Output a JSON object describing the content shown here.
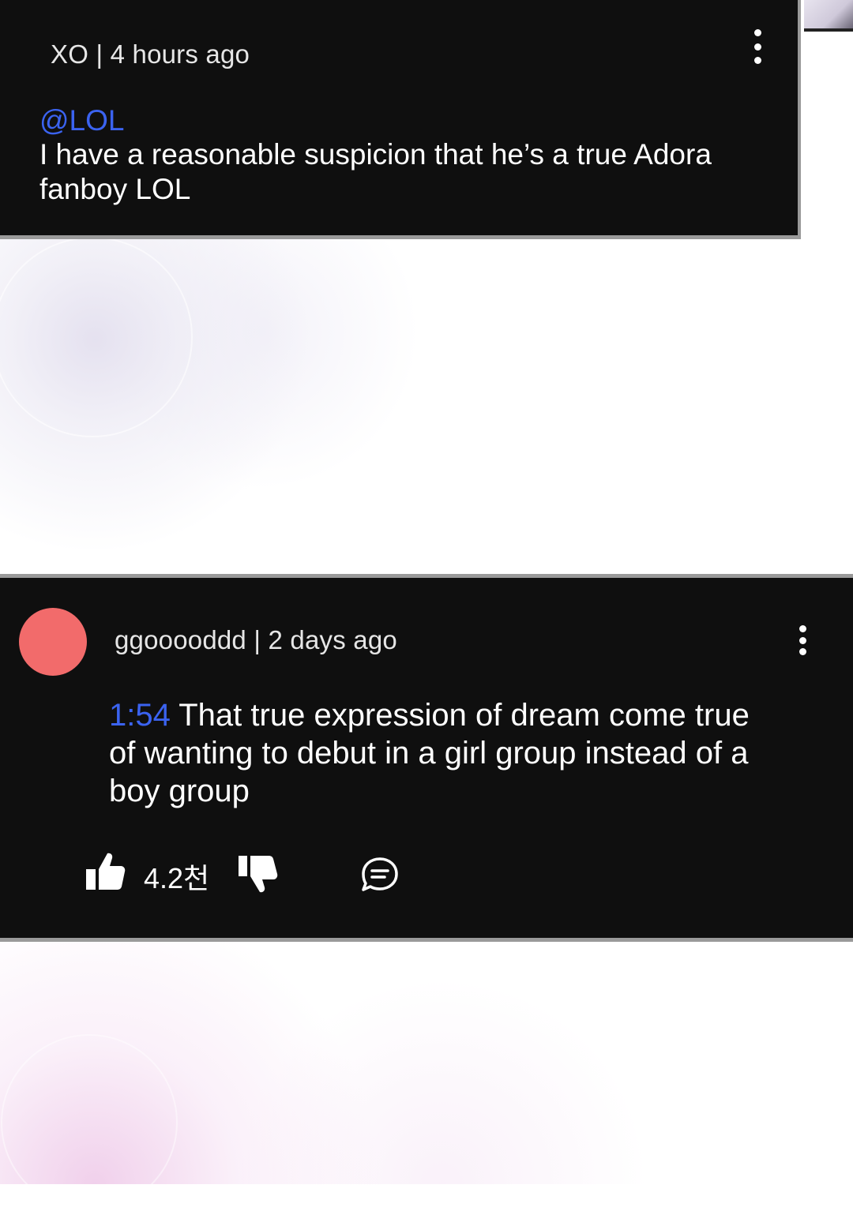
{
  "comments": [
    {
      "author": "XO",
      "separator": "|",
      "time": "4 hours ago",
      "meta": "XO | 4 hours ago",
      "mention": "@LOL",
      "text": "I have a reasonable suspicion that he’s a true Adora fanboy LOL",
      "more_icon": "more-vert-icon"
    },
    {
      "author": "ggooooddd",
      "separator": "|",
      "time": "2 days ago",
      "meta": "ggooooddd | 2 days ago",
      "avatar_color": "#f26b6b",
      "timestamp_link": "1:54",
      "text": " That true expression of dream come true of wanting to debut in a girl group instead of a boy group",
      "like_count": "4.2천",
      "icons": {
        "like": "thumbs-up-icon",
        "dislike": "thumbs-down-icon",
        "reply": "comment-bubble-icon",
        "more": "more-vert-icon"
      }
    }
  ],
  "colors": {
    "card_bg": "#0f0f0f",
    "link_blue": "#3b63f0",
    "card_border": "#9a9a9a"
  }
}
